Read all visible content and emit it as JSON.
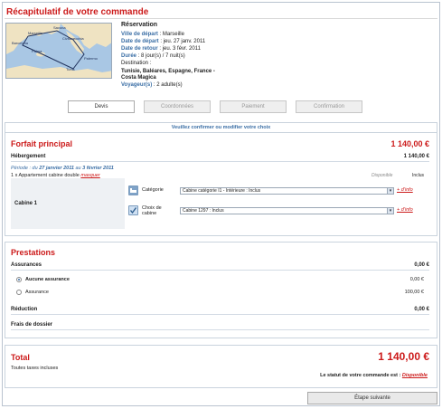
{
  "header": {
    "title": "Récapitulatif de votre commande"
  },
  "map": {
    "cities": [
      "Marseille",
      "Barcelona",
      "Savona",
      "Civitavecchia",
      "Palma",
      "Tunis",
      "Palermo"
    ]
  },
  "reservation": {
    "heading": "Réservation",
    "departure_city_label": "Ville de départ",
    "departure_city": " : Marseille",
    "departure_date_label": "Date de départ",
    "departure_date": " : jeu. 27 janv. 2011",
    "return_date_label": "Date de retour",
    "return_date": " : jeu. 3 févr. 2011",
    "duration_label": "Durée",
    "duration": " : 8 jour(s) / 7 nuit(s)",
    "destination_label": "Destination :",
    "destination": "Tunisie, Baléares, Espagne, France - Costa Magica",
    "travelers_label": "Voyageur(s)",
    "travelers": " : 2 adulte(s)"
  },
  "steps": [
    "Devis",
    "Coordonnées",
    "Paiement",
    "Confirmation"
  ],
  "confirm_banner": "Veuillez confirmer ou modifier votre choix",
  "forfait": {
    "title": "Forfait principal",
    "amount": "1 140,00  €",
    "hebergement_label": "Hébergement",
    "hebergement_amount": "1 140,00  €",
    "period_prefix": "Période : du ",
    "period_from": "27 janvier 2011",
    "period_mid": " au ",
    "period_to": "3 février 2011",
    "item": "1 x Appartement cabine double ",
    "hide_link": "masquer",
    "status": "Disponible",
    "included": "Inclus",
    "cabin_label": "Cabine 1",
    "category_label": "Catégorie",
    "category_value": "Cabine catégorie I1 - Intérieure : Inclus",
    "cabin_choice_label": "Choix de cabine",
    "cabin_choice_value": "Cabine 1297 : Inclus",
    "more_info": "+ d'info"
  },
  "prestations": {
    "title": "Prestations",
    "assurances_label": "Assurances",
    "assurances_amount": "0,00  €",
    "option1": "Aucune assurance",
    "option1_amount": "0,00 €",
    "option2": "Assurance",
    "option2_amount": "100,00 €",
    "reduction_label": "Réduction",
    "reduction_amount": "0,00  €",
    "frais_label": "Frais de dossier"
  },
  "total": {
    "title": "Total",
    "amount": "1 140,00  €",
    "taxes": "Toutes taxes incluses",
    "status_text": "Le statut de votre commande est : ",
    "status_value": "Disponible"
  },
  "next_button": "Étape suivante",
  "colors": {
    "accent": "#cc1a1a",
    "link": "#3a6ea5",
    "border": "#c9d3dd"
  }
}
